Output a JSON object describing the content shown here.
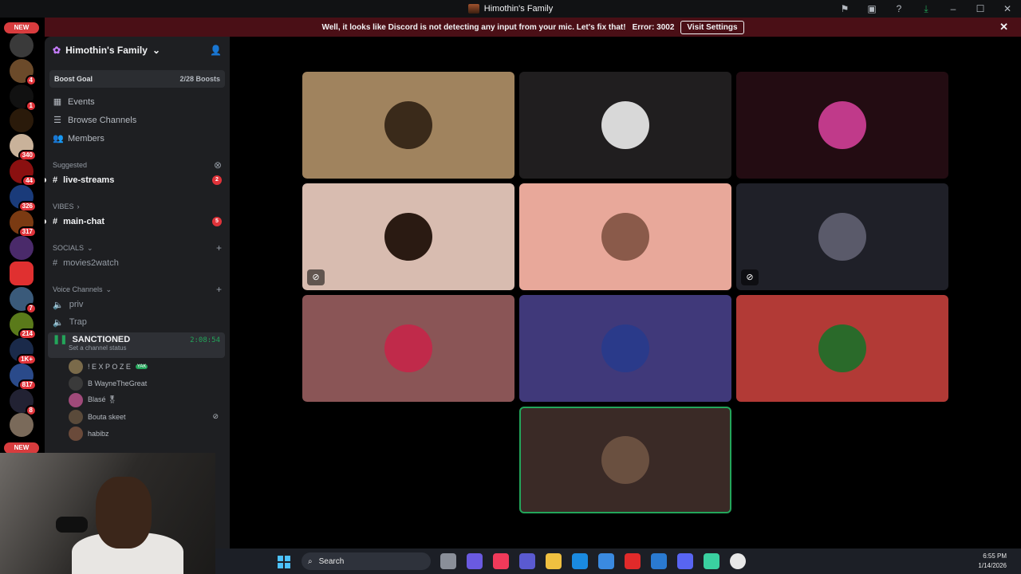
{
  "window": {
    "title": "Himothin's Family"
  },
  "banner": {
    "message": "Well, it looks like Discord is not detecting any input from your mic. Let's fix that!",
    "error": "Error: 3002",
    "button": "Visit Settings"
  },
  "rail": {
    "new_top": "NEW",
    "new_bottom": "NEW",
    "badges": [
      "4",
      "1",
      "340",
      "44",
      "326",
      "317",
      "7",
      "214",
      "1K+",
      "817",
      "8"
    ]
  },
  "sidebar": {
    "guild_name": "Himothin's Family",
    "boost": {
      "label": "Boost Goal",
      "count": "2/28 Boosts"
    },
    "nav": [
      {
        "label": "Events",
        "icon": "calendar-icon"
      },
      {
        "label": "Browse Channels",
        "icon": "list-icon"
      },
      {
        "label": "Members",
        "icon": "members-icon"
      }
    ],
    "suggested": {
      "label": "Suggested",
      "channel": "live-streams",
      "count": "2"
    },
    "vibes": {
      "label": "VIBES",
      "channel": "main-chat",
      "count": "5"
    },
    "socials": {
      "label": "SOCIALS",
      "channel": "movies2watch"
    },
    "voice": {
      "label": "Voice Channels",
      "channels": [
        "priv",
        "Trap"
      ],
      "active": {
        "name": "SANCTIONED",
        "time": "2:08:54",
        "status": "Set a channel status"
      },
      "users": [
        {
          "name": "! E X P O Z E",
          "tag": "YAK"
        },
        {
          "name": "B WayneTheGreat"
        },
        {
          "name": "Blasé 🎖"
        },
        {
          "name": "Bouta skeet"
        },
        {
          "name": "habibz"
        }
      ]
    }
  },
  "stage": {
    "tiles": [
      {
        "bg": "#a0835e"
      },
      {
        "bg": "#201e1f"
      },
      {
        "bg": "#230c12"
      },
      {
        "bg": "#d8bcb0",
        "indicator": "mic-off-icon"
      },
      {
        "bg": "#e8a89a"
      },
      {
        "bg": "#1f2028",
        "indicator": "camera-off-icon"
      },
      {
        "bg": "#8a5556"
      },
      {
        "bg": "#40397a"
      },
      {
        "bg": "#b23a36"
      },
      {
        "bg": "#3a2a26",
        "speaking": true
      }
    ]
  },
  "taskbar": {
    "search": "Search",
    "time": "6:55 PM",
    "date": "1/14/2026"
  },
  "colors": {
    "accent_green": "#23a55a",
    "danger": "#e0333a",
    "banner": "#4a0f16"
  }
}
